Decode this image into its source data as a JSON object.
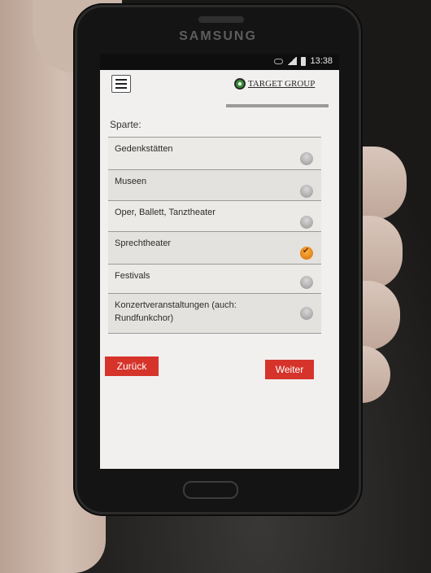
{
  "device": {
    "brand": "SAMSUNG"
  },
  "status_bar": {
    "time": "13:38"
  },
  "app": {
    "logo_text": "TARGET GROUP"
  },
  "form": {
    "section_label": "Sparte:",
    "options": [
      {
        "label": "Gedenkstätten",
        "selected": false
      },
      {
        "label": "Museen",
        "selected": false
      },
      {
        "label": "Oper, Ballett, Tanztheater",
        "selected": false
      },
      {
        "label": "Sprechtheater",
        "selected": true
      },
      {
        "label": "Festivals",
        "selected": false
      },
      {
        "label": "Konzertveranstaltungen (auch: Rundfunkchor)",
        "selected": false
      }
    ]
  },
  "buttons": {
    "back": "Zurück",
    "next": "Weiter"
  },
  "colors": {
    "accent": "#d6332b",
    "selected_radio": "#e58a1c",
    "logo_pin": "#3a8f3a"
  }
}
